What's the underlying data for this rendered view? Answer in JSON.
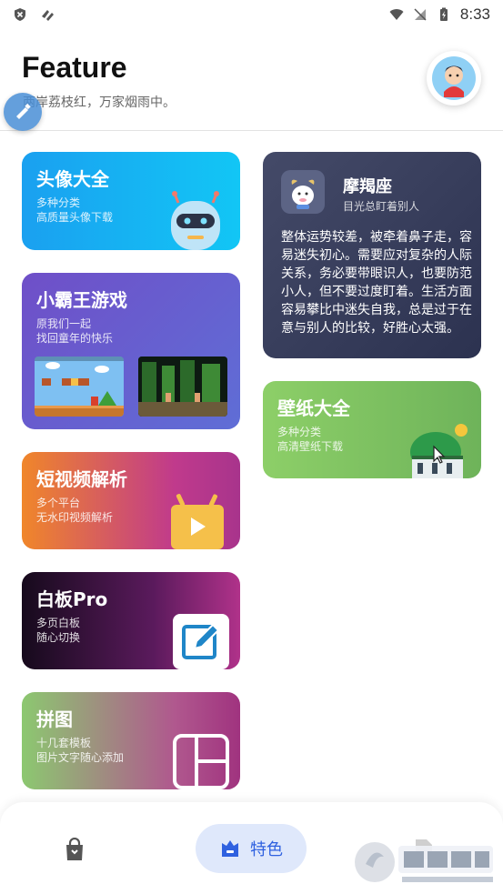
{
  "status_bar": {
    "time": "8:33"
  },
  "header": {
    "title": "Feature",
    "subtitle": "两岸荔枝红，万家烟雨中。"
  },
  "cards": {
    "avatar": {
      "title": "头像大全",
      "desc1": "多种分类",
      "desc2": "高质量头像下载"
    },
    "game": {
      "title": "小霸王游戏",
      "desc1": "原我们一起",
      "desc2": "找回童年的快乐"
    },
    "video": {
      "title": "短视频解析",
      "desc1": "多个平台",
      "desc2": "无水印视频解析"
    },
    "board": {
      "title": "白板Pro",
      "desc1": "多页白板",
      "desc2": "随心切换"
    },
    "puzzle": {
      "title": "拼图",
      "desc1": "十几套模板",
      "desc2": "图片文字随心添加"
    },
    "zodiac": {
      "name": "摩羯座",
      "sub": "目光总盯着别人",
      "text": "整体运势较差，被牵着鼻子走，容易迷失初心。需要应对复杂的人际关系，务必要带眼识人，也要防范小人，但不要过度盯着。生活方面容易攀比中迷失自我，总是过于在意与别人的比较，好胜心太强。"
    },
    "wallpaper": {
      "title": "壁纸大全",
      "desc1": "多种分类",
      "desc2": "高清壁纸下载"
    }
  },
  "bottom_nav": {
    "active_label": "特色"
  },
  "colors": {
    "accent": "#2f61e0",
    "active_pill": "#dfe8fb"
  },
  "icons": [
    "shield-icon",
    "wifi-icon",
    "battery-icon",
    "robot-icon",
    "play-icon",
    "edit-icon",
    "layout-icon",
    "shopping-bag-icon",
    "briefcase-icon"
  ]
}
